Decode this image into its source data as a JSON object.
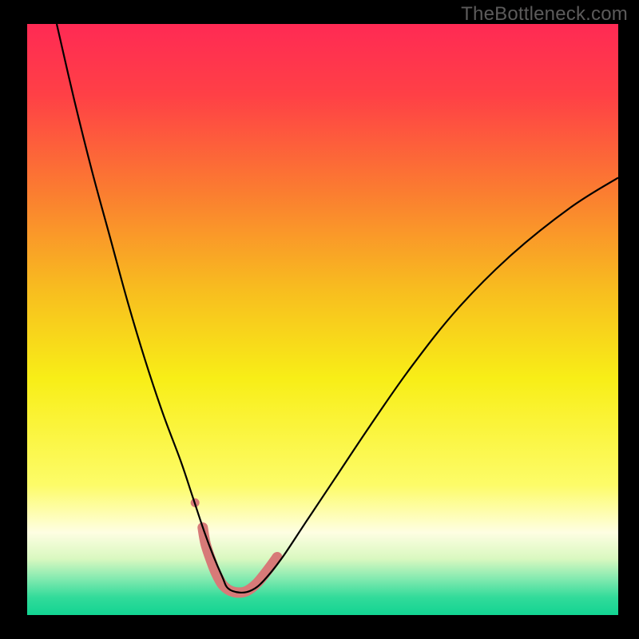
{
  "watermark": "TheBottleneck.com",
  "chart_data": {
    "type": "line",
    "title": "",
    "xlabel": "",
    "ylabel": "",
    "xlim": [
      0,
      100
    ],
    "ylim": [
      0,
      100
    ],
    "grid": false,
    "legend": false,
    "background_gradient": {
      "stops": [
        {
          "offset": 0.0,
          "color": "#ff2a54"
        },
        {
          "offset": 0.12,
          "color": "#ff4046"
        },
        {
          "offset": 0.28,
          "color": "#fb7b31"
        },
        {
          "offset": 0.45,
          "color": "#f8bd1f"
        },
        {
          "offset": 0.6,
          "color": "#f8ee17"
        },
        {
          "offset": 0.78,
          "color": "#fdfc68"
        },
        {
          "offset": 0.86,
          "color": "#fefee2"
        },
        {
          "offset": 0.905,
          "color": "#d9f8c0"
        },
        {
          "offset": 0.94,
          "color": "#7fe9af"
        },
        {
          "offset": 0.97,
          "color": "#32db9a"
        },
        {
          "offset": 1.0,
          "color": "#12d492"
        }
      ]
    },
    "series": [
      {
        "name": "bottleneck-curve",
        "stroke": "#000000",
        "stroke_width": 2.2,
        "x": [
          5,
          8,
          11,
          14,
          17,
          20,
          23,
          26,
          28,
          30,
          31.5,
          33,
          34,
          36,
          38,
          40,
          43,
          47,
          52,
          58,
          65,
          73,
          82,
          92,
          100
        ],
        "y": [
          100,
          87,
          75,
          64,
          53,
          43,
          34,
          26,
          20,
          14,
          10,
          6.5,
          4.5,
          3.8,
          4.2,
          5.8,
          9.5,
          15.5,
          23,
          32,
          42,
          52,
          61,
          69,
          74
        ]
      },
      {
        "name": "highlight-band",
        "stroke": "#d77a78",
        "stroke_width": 13,
        "linecap": "round",
        "x": [
          29.7,
          30.2,
          31.2,
          32.0,
          33.0,
          34.0,
          35.0,
          36.0,
          37.0,
          38.0,
          39.0,
          40.0,
          41.0,
          42.3
        ],
        "y": [
          14.8,
          12.0,
          9.0,
          7.0,
          5.2,
          4.3,
          3.9,
          3.8,
          4.0,
          4.6,
          5.5,
          6.7,
          8.0,
          9.8
        ]
      }
    ],
    "markers": [
      {
        "name": "highlight-dot",
        "x": 28.4,
        "y": 19.0,
        "r": 5.5,
        "fill": "#d77a78"
      }
    ]
  }
}
